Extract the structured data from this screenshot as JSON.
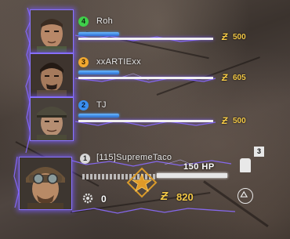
{
  "players": [
    {
      "number": "4",
      "name": "Roh",
      "points": "500",
      "badge_color": "#3fcf4a",
      "hp_fraction": 0.2
    },
    {
      "number": "3",
      "name": "xxARTIExx",
      "points": "605",
      "badge_color": "#f0a830",
      "hp_fraction": 0.2
    },
    {
      "number": "2",
      "name": "TJ",
      "points": "500",
      "badge_color": "#3a8ff0",
      "hp_fraction": 0.2
    }
  ],
  "self": {
    "number": "1",
    "name": "[115]SupremeTaco",
    "hp_label": "150 HP",
    "points": "820",
    "salvage": "0",
    "equipment_count": "3",
    "badge_color": "#e0e0e0"
  },
  "colors": {
    "points": "#f4c946",
    "lightning": "#7b5cff",
    "hp_blue": "#4a9aff"
  }
}
